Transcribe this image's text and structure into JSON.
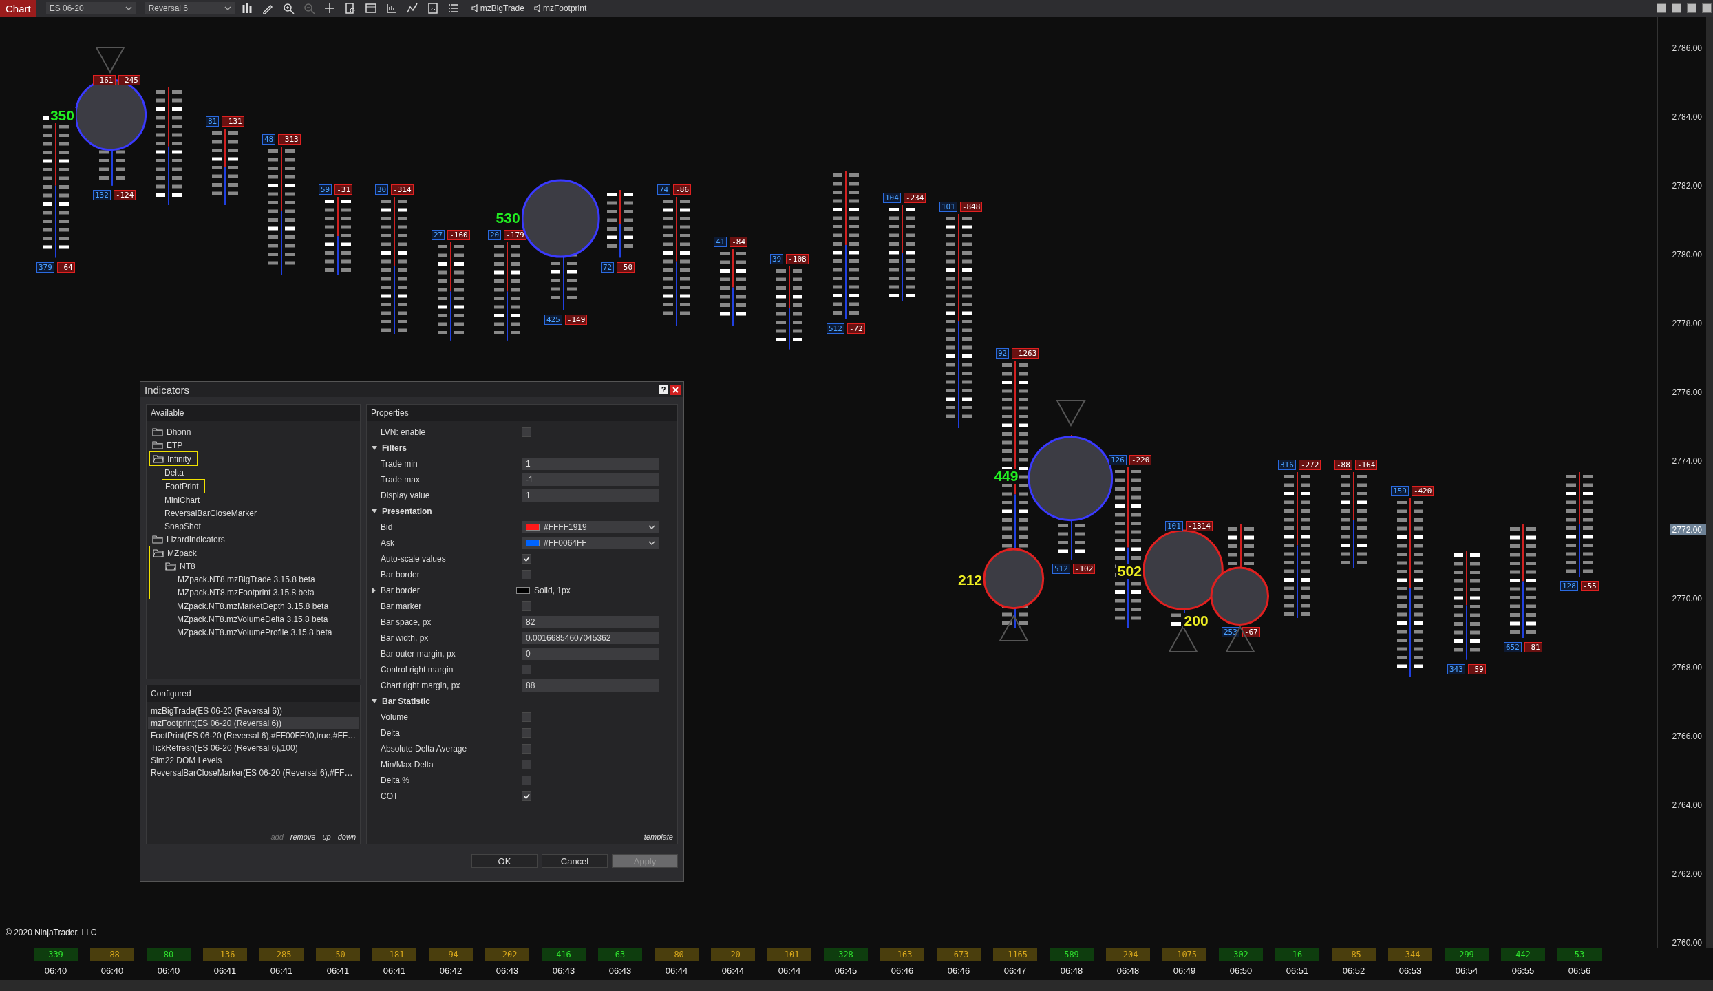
{
  "toolbar": {
    "tab": "Chart",
    "instrument": "ES 06-20",
    "bar_type": "Reversal 6",
    "indicators": [
      "mzBigTrade",
      "mzFootprint"
    ]
  },
  "chart": {
    "copyright": "© 2020 NinjaTrader, LLC",
    "price_axis": [
      {
        "text": "2786.00",
        "current": false
      },
      {
        "text": "2784.00",
        "current": false
      },
      {
        "text": "2782.00",
        "current": false
      },
      {
        "text": "2780.00",
        "current": false
      },
      {
        "text": "2778.00",
        "current": false
      },
      {
        "text": "2776.00",
        "current": false
      },
      {
        "text": "2774.00",
        "current": false
      },
      {
        "text": "2772.00",
        "current": true
      },
      {
        "text": "2770.00",
        "current": false
      },
      {
        "text": "2768.00",
        "current": false
      },
      {
        "text": "2766.00",
        "current": false
      },
      {
        "text": "2764.00",
        "current": false
      },
      {
        "text": "2762.00",
        "current": false
      },
      {
        "text": "2760.00",
        "current": false
      }
    ],
    "bars": [
      {
        "bottom": [
          {
            "text": "379",
            "kind": "ask"
          },
          {
            "text": "-64",
            "kind": "bid"
          }
        ],
        "big": {
          "text": "350",
          "color": "#22ee22"
        }
      },
      {
        "top": [
          {
            "text": "-161",
            "kind": "bid"
          },
          {
            "text": "-245",
            "kind": "bid"
          }
        ],
        "bottom": [
          {
            "text": "132",
            "kind": "ask"
          },
          {
            "text": "-124",
            "kind": "bid"
          }
        ],
        "bubble": {
          "color": "#3a3aff"
        }
      },
      {
        "kind": "footprint"
      },
      {
        "top": [
          {
            "text": "81",
            "kind": "ask"
          },
          {
            "text": "-131",
            "kind": "bid"
          }
        ]
      },
      {
        "top": [
          {
            "text": "48",
            "kind": "ask"
          },
          {
            "text": "-313",
            "kind": "bid"
          }
        ]
      },
      {
        "top": [
          {
            "text": "59",
            "kind": "ask"
          },
          {
            "text": "-31",
            "kind": "bid"
          }
        ]
      },
      {
        "top": [
          {
            "text": "30",
            "kind": "ask"
          },
          {
            "text": "-314",
            "kind": "bid"
          }
        ]
      },
      {
        "top": [
          {
            "text": "27",
            "kind": "ask"
          },
          {
            "text": "-160",
            "kind": "bid"
          }
        ]
      },
      {
        "top": [
          {
            "text": "20",
            "kind": "ask"
          },
          {
            "text": "-179",
            "kind": "bid"
          }
        ],
        "big": {
          "text": "530",
          "color": "#22ee22"
        }
      },
      {
        "bottom": [
          {
            "text": "425",
            "kind": "ask"
          },
          {
            "text": "-149",
            "kind": "bid"
          }
        ],
        "bubble": {
          "color": "#3a3aff"
        }
      },
      {
        "bottom": [
          {
            "text": "72",
            "kind": "ask"
          },
          {
            "text": "-50",
            "kind": "bid"
          }
        ]
      },
      {
        "top": [
          {
            "text": "74",
            "kind": "ask"
          },
          {
            "text": "-86",
            "kind": "bid"
          }
        ]
      },
      {
        "top": [
          {
            "text": "41",
            "kind": "ask"
          },
          {
            "text": "-84",
            "kind": "bid"
          }
        ]
      },
      {
        "top": [
          {
            "text": "39",
            "kind": "ask"
          },
          {
            "text": "-108",
            "kind": "bid"
          }
        ]
      },
      {
        "bottom": [
          {
            "text": "512",
            "kind": "ask"
          },
          {
            "text": "-72",
            "kind": "bid"
          }
        ]
      },
      {
        "top": [
          {
            "text": "104",
            "kind": "ask"
          },
          {
            "text": "-234",
            "kind": "bid"
          }
        ]
      },
      {
        "top": [
          {
            "text": "101",
            "kind": "ask"
          },
          {
            "text": "-848",
            "kind": "bid"
          }
        ]
      },
      {
        "top": [
          {
            "text": "92",
            "kind": "ask"
          },
          {
            "text": "-1263",
            "kind": "bid"
          }
        ],
        "big": {
          "text": "212",
          "color": "#eeee22"
        },
        "bubble": {
          "color": "#e02020"
        }
      },
      {
        "bottom": [
          {
            "text": "512",
            "kind": "ask"
          },
          {
            "text": "-102",
            "kind": "bid"
          }
        ],
        "big": {
          "text": "449",
          "color": "#22ee22"
        },
        "bubble": {
          "color": "#3a3aff"
        }
      },
      {
        "top": [
          {
            "text": "126",
            "kind": "ask"
          },
          {
            "text": "-220",
            "kind": "bid"
          }
        ]
      },
      {
        "top": [
          {
            "text": "101",
            "kind": "ask"
          },
          {
            "text": "-1314",
            "kind": "bid"
          }
        ],
        "big": {
          "text": "502",
          "color": "#eeee22"
        },
        "bubble": {
          "color": "#e02020"
        }
      },
      {
        "bottom": [
          {
            "text": "253",
            "kind": "ask"
          },
          {
            "text": "-67",
            "kind": "bid"
          }
        ],
        "big": {
          "text": "200",
          "color": "#eeee22"
        },
        "bubble": {
          "color": "#e02020"
        }
      },
      {
        "top": [
          {
            "text": "316",
            "kind": "ask"
          },
          {
            "text": "-272",
            "kind": "bid"
          }
        ]
      },
      {
        "top": [
          {
            "text": "-88",
            "kind": "bid"
          },
          {
            "text": "-164",
            "kind": "bid"
          }
        ]
      },
      {
        "top": [
          {
            "text": "159",
            "kind": "ask"
          },
          {
            "text": "-420",
            "kind": "bid"
          }
        ]
      },
      {
        "bottom": [
          {
            "text": "343",
            "kind": "ask"
          },
          {
            "text": "-59",
            "kind": "bid"
          }
        ]
      },
      {
        "bottom": [
          {
            "text": "652",
            "kind": "ask"
          },
          {
            "text": "-81",
            "kind": "bid"
          }
        ]
      },
      {
        "bottom": [
          {
            "text": "128",
            "kind": "ask"
          },
          {
            "text": "-55",
            "kind": "bid"
          }
        ]
      }
    ]
  },
  "bar_deltas": [
    {
      "text": "339",
      "kind": "positive"
    },
    {
      "text": "-88",
      "kind": "negative"
    },
    {
      "text": "80",
      "kind": "positive"
    },
    {
      "text": "-136",
      "kind": "negative"
    },
    {
      "text": "-285",
      "kind": "negative"
    },
    {
      "text": "-50",
      "kind": "negative"
    },
    {
      "text": "-181",
      "kind": "negative"
    },
    {
      "text": "-94",
      "kind": "negative"
    },
    {
      "text": "-202",
      "kind": "negative"
    },
    {
      "text": "416",
      "kind": "positive"
    },
    {
      "text": "63",
      "kind": "positive"
    },
    {
      "text": "-80",
      "kind": "negative"
    },
    {
      "text": "-20",
      "kind": "negative"
    },
    {
      "text": "-101",
      "kind": "negative"
    },
    {
      "text": "328",
      "kind": "positive"
    },
    {
      "text": "-163",
      "kind": "negative"
    },
    {
      "text": "-673",
      "kind": "negative"
    },
    {
      "text": "-1165",
      "kind": "negative"
    },
    {
      "text": "589",
      "kind": "positive"
    },
    {
      "text": "-204",
      "kind": "negative"
    },
    {
      "text": "-1075",
      "kind": "negative"
    },
    {
      "text": "302",
      "kind": "positive"
    },
    {
      "text": "16",
      "kind": "positive"
    },
    {
      "text": "-85",
      "kind": "negative"
    },
    {
      "text": "-344",
      "kind": "negative"
    },
    {
      "text": "299",
      "kind": "positive"
    },
    {
      "text": "442",
      "kind": "positive"
    },
    {
      "text": "53",
      "kind": "positive"
    }
  ],
  "times": [
    "06:40",
    "06:40",
    "06:40",
    "06:41",
    "06:41",
    "06:41",
    "06:41",
    "06:42",
    "06:43",
    "06:43",
    "06:43",
    "06:44",
    "06:44",
    "06:44",
    "06:45",
    "06:46",
    "06:46",
    "06:47",
    "06:48",
    "06:48",
    "06:49",
    "06:50",
    "06:51",
    "06:52",
    "06:53",
    "06:54",
    "06:55",
    "06:56"
  ],
  "dialog": {
    "title": "Indicators",
    "help": "?",
    "available_title": "Available",
    "properties_title": "Properties",
    "configured_title": "Configured",
    "tree": [
      {
        "kind": "folder",
        "label": "Dhonn",
        "highlighted": false,
        "expanded": false
      },
      {
        "kind": "folder",
        "label": "ETP",
        "highlighted": false,
        "expanded": false
      },
      {
        "kind": "folder",
        "label": "Infinity",
        "highlighted": true,
        "expanded": true,
        "children": [
          {
            "label": "Delta",
            "highlighted": false
          },
          {
            "label": "FootPrint",
            "highlighted": true
          },
          {
            "label": "MiniChart",
            "highlighted": false
          },
          {
            "label": "ReversalBarCloseMarker",
            "highlighted": false
          },
          {
            "label": "SnapShot",
            "highlighted": false
          }
        ]
      },
      {
        "kind": "folder",
        "label": "LizardIndicators",
        "highlighted": false,
        "expanded": false
      },
      {
        "kind": "folder",
        "label": "MZpack",
        "highlighted": true,
        "expanded": true,
        "children": [
          {
            "kind": "folder",
            "label": "NT8",
            "highlighted": true,
            "expanded": true,
            "children": [
              {
                "label": "MZpack.NT8.mzBigTrade 3.15.8 beta",
                "highlighted": true
              },
              {
                "label": "MZpack.NT8.mzFootprint 3.15.8 beta",
                "highlighted": true
              },
              {
                "label": "MZpack.NT8.mzMarketDepth 3.15.8 beta",
                "highlighted": false
              },
              {
                "label": "MZpack.NT8.mzVolumeDelta 3.15.8 beta",
                "highlighted": false
              },
              {
                "label": "MZpack.NT8.mzVolumeProfile 3.15.8 beta",
                "highlighted": false
              }
            ]
          }
        ]
      }
    ],
    "configured": [
      {
        "label": "mzBigTrade(ES 06-20 (Reversal 6))",
        "selected": false
      },
      {
        "label": "mzFootprint(ES 06-20 (Reversal 6))",
        "selected": true
      },
      {
        "label": "FootPrint(ES 06-20 (Reversal 6),#FF00FF00,true,#FF…",
        "selected": false
      },
      {
        "label": "TickRefresh(ES 06-20 (Reversal 6),100)",
        "selected": false
      },
      {
        "label": "Sim22 DOM Levels",
        "selected": false
      },
      {
        "label": "ReversalBarCloseMarker(ES 06-20 (Reversal 6),#FF…",
        "selected": false
      }
    ],
    "list_actions": [
      {
        "label": "add",
        "disabled": true
      },
      {
        "label": "remove",
        "disabled": false
      },
      {
        "label": "up",
        "disabled": false
      },
      {
        "label": "down",
        "disabled": false
      }
    ],
    "properties": [
      {
        "kind": "checkbox",
        "label": "LVN: enable",
        "checked": false
      },
      {
        "kind": "category",
        "label": "Filters",
        "expanded": true
      },
      {
        "kind": "text",
        "label": "Trade min",
        "value": "1"
      },
      {
        "kind": "text",
        "label": "Trade max",
        "value": "-1"
      },
      {
        "kind": "text",
        "label": "Display value",
        "value": "1"
      },
      {
        "kind": "category",
        "label": "Presentation",
        "expanded": true
      },
      {
        "kind": "color",
        "label": "Bid",
        "value": "#FFFF1919",
        "color": "#ff1919"
      },
      {
        "kind": "color",
        "label": "Ask",
        "value": "#FF0064FF",
        "color": "#0064ff"
      },
      {
        "kind": "checkbox",
        "label": "Auto-scale values",
        "checked": true
      },
      {
        "kind": "checkbox",
        "label": "Bar border",
        "checked": false
      },
      {
        "kind": "stroke",
        "label": "Bar border",
        "value": "Solid, 1px",
        "color": "#000000",
        "expanded": false
      },
      {
        "kind": "checkbox",
        "label": "Bar marker",
        "checked": false
      },
      {
        "kind": "text",
        "label": "Bar space, px",
        "value": "82"
      },
      {
        "kind": "text",
        "label": "Bar width, px",
        "value": "0.00166854607045362"
      },
      {
        "kind": "text",
        "label": "Bar outer margin, px",
        "value": "0"
      },
      {
        "kind": "checkbox",
        "label": "Control right margin",
        "checked": false
      },
      {
        "kind": "text",
        "label": "Chart right margin, px",
        "value": "88"
      },
      {
        "kind": "category",
        "label": "Bar Statistic",
        "expanded": true
      },
      {
        "kind": "checkbox",
        "label": "Volume",
        "checked": false
      },
      {
        "kind": "checkbox",
        "label": "Delta",
        "checked": false
      },
      {
        "kind": "checkbox",
        "label": "Absolute Delta Average",
        "checked": false
      },
      {
        "kind": "checkbox",
        "label": "Min/Max Delta",
        "checked": false
      },
      {
        "kind": "checkbox",
        "label": "Delta %",
        "checked": false
      },
      {
        "kind": "checkbox",
        "label": "COT",
        "checked": true
      }
    ],
    "template_link": "template",
    "buttons": [
      {
        "label": "OK",
        "disabled": false
      },
      {
        "label": "Cancel",
        "disabled": false
      },
      {
        "label": "Apply",
        "disabled": true
      }
    ]
  }
}
